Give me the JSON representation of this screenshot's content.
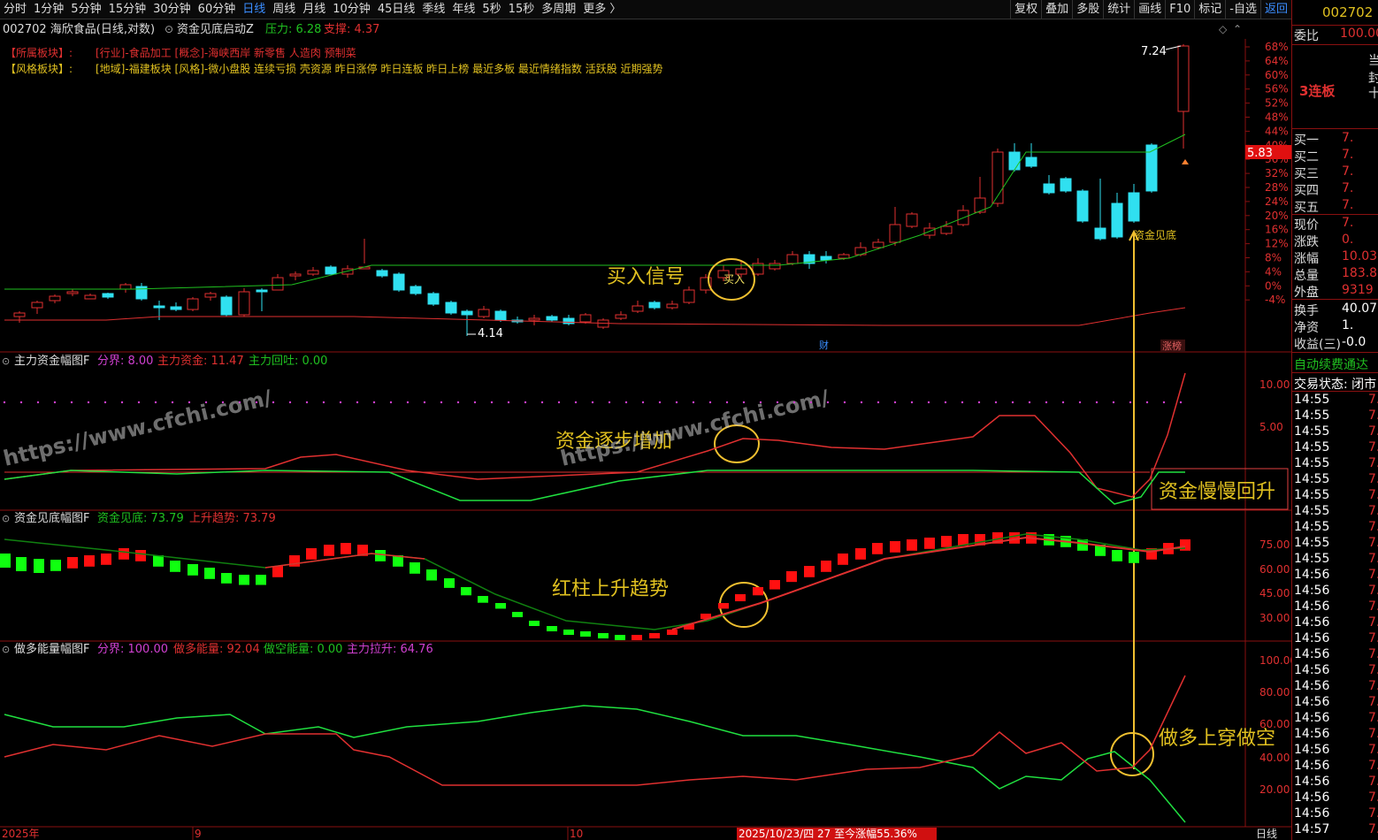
{
  "toolbar": {
    "periods": [
      "分时",
      "1分钟",
      "5分钟",
      "15分钟",
      "30分钟",
      "60分钟",
      "日线",
      "周线",
      "月线",
      "10分钟",
      "45日线",
      "季线",
      "年线",
      "5秒",
      "15秒",
      "多周期",
      "更多 〉"
    ],
    "active": "日线",
    "tools": [
      "复权",
      "叠加",
      "多股",
      "统计",
      "画线",
      "F10",
      "标记",
      "-自选",
      "返回"
    ]
  },
  "header": {
    "code_name": "002702 海欣食品(日线,对数)",
    "indicator": "资金见底启动Z",
    "pressure": "压力: 6.28",
    "support": "支撑: 4.37"
  },
  "sectors": {
    "line1_label": "【所属板块】:",
    "line1": "[行业]-食品加工 [概念]-海峡西岸 新零售 人造肉 预制菜",
    "line2_label": "【风格板块】:",
    "line2": "[地域]-福建板块 [风格]-微小盘股 连续亏损 壳资源 昨日涨停 昨日连板 昨日上榜 最近多板 最近情绪指数 活跃股 近期强势"
  },
  "main_chart": {
    "high_label": "7.24",
    "low_label": "4.14",
    "buy_marker": "买入",
    "bottom_marker": "资金见底",
    "fin_marker": "财",
    "limit_marker": "涨榜",
    "current_price": "5.83",
    "pct_axis": [
      "68%",
      "64%",
      "60%",
      "56%",
      "52%",
      "48%",
      "44%",
      "40%",
      "36%",
      "32%",
      "28%",
      "24%",
      "20%",
      "16%",
      "12%",
      "8%",
      "4%",
      "0%",
      "-4%"
    ]
  },
  "annotations": {
    "buy_signal": "买入信号",
    "fund_increase": "资金逐步增加",
    "fund_recover": "资金慢慢回升",
    "red_trend": "红柱上升趋势",
    "long_cross": "做多上穿做空",
    "wm1": "https://www.cfchi.com/",
    "wm2": "https://www.cfchi.com/"
  },
  "panel1": {
    "title": "主力资金幅图F",
    "f1": "分界: 8.00",
    "f2": "主力资金: 11.47",
    "f3": "主力回吐: 0.00",
    "axis": [
      "10.00",
      "5.00"
    ]
  },
  "panel2": {
    "title": "资金见底幅图F",
    "f1": "资金见底: 73.79",
    "f2": "上升趋势: 73.79",
    "axis": [
      "75.00",
      "60.00",
      "45.00",
      "30.00"
    ]
  },
  "panel3": {
    "title": "做多能量幅图F",
    "f1": "分界: 100.00",
    "f2": "做多能量: 92.04",
    "f3": "做空能量: 0.00",
    "f4": "主力拉升: 64.76",
    "axis": [
      "100.00",
      "80.00",
      "60.00",
      "40.00",
      "20.00"
    ]
  },
  "timeline": {
    "start": "2025年",
    "m9": "9",
    "m10": "10",
    "highlight": "2025/10/23/四 27 至今涨幅55.36%",
    "tab": "日线"
  },
  "right_panel": {
    "code": "002702",
    "weibi_label": "委比",
    "weibi": "100.00",
    "side_chars": [
      "当",
      "封",
      "十"
    ],
    "streak": "3连板",
    "bids": [
      [
        "买一",
        "7."
      ],
      [
        "买二",
        "7."
      ],
      [
        "买三",
        "7."
      ],
      [
        "买四",
        "7."
      ],
      [
        "买五",
        "7."
      ]
    ],
    "stats": [
      [
        "现价",
        "7."
      ],
      [
        "涨跌",
        "0."
      ],
      [
        "涨幅",
        "10.03"
      ],
      [
        "总量",
        "183.8"
      ],
      [
        "外盘",
        "9319"
      ]
    ],
    "stats2": [
      [
        "换手",
        "40.07"
      ],
      [
        "净资",
        "1."
      ],
      [
        "收益(三)",
        "-0.0"
      ]
    ],
    "promo": "自动续费通达",
    "trade_state": "交易状态: 闭市",
    "ticks": [
      "14:55",
      "14:55",
      "14:55",
      "14:55",
      "14:55",
      "14:55",
      "14:55",
      "14:55",
      "14:55",
      "14:55",
      "14:55",
      "14:56",
      "14:56",
      "14:56",
      "14:56",
      "14:56",
      "14:56",
      "14:56",
      "14:56",
      "14:56",
      "14:56",
      "14:56",
      "14:56",
      "14:56",
      "14:56",
      "14:56",
      "14:56",
      "14:57"
    ]
  }
}
